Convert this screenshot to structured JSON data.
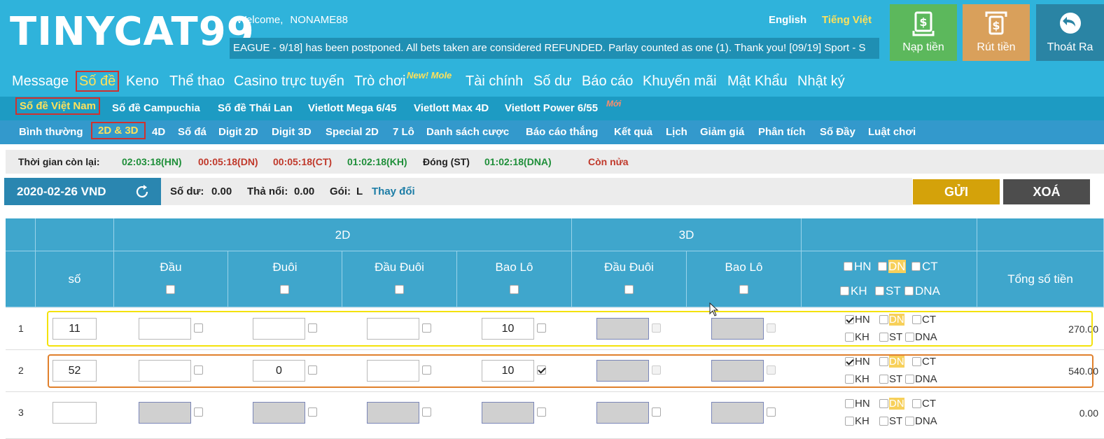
{
  "header": {
    "logo": "TINYCAT99",
    "welcome_label": "Welcome,",
    "username": "NONAME88",
    "lang_english": "English",
    "lang_vietnamese": "Tiếng Việt",
    "marquee": "EAGUE - 9/18] has been postponed. All bets taken are considered REFUNDED. Parlay counted as one (1). Thank you!      [09/19] Sport - S",
    "deposit": "Nạp tiền",
    "withdraw": "Rút tiền",
    "logout": "Thoát Ra"
  },
  "nav": {
    "items": [
      "Message",
      "Số đề",
      "Keno",
      "Thể thao",
      "Casino trực tuyến",
      "Trò chơi",
      "Tài chính",
      "Số dư",
      "Báo cáo",
      "Khuyến mãi",
      "Mật Khẩu",
      "Nhật ký"
    ],
    "new_badge": "New! Mole"
  },
  "subnav": {
    "items": [
      "Số đề Việt Nam",
      "Số đề Campuchia",
      "Số đề Thái Lan",
      "Vietlott Mega 6/45",
      "Vietlott Max 4D",
      "Vietlott Power 6/55"
    ],
    "new_badge": "Mới"
  },
  "gamenav": {
    "items": [
      "Bình thường",
      "2D & 3D",
      "4D",
      "Số đá",
      "Digit 2D",
      "Digit 3D",
      "Special 2D",
      "7 Lô",
      "Danh sách cược",
      "Báo cáo thắng",
      "Kết quả",
      "Lịch",
      "Giảm giá",
      "Phân tích",
      "Số Đầy",
      "Luật chơi"
    ]
  },
  "timer": {
    "label": "Thời gian còn lại:",
    "hn": "02:03:18(HN)",
    "dn": "00:05:18(DN)",
    "ct": "00:05:18(CT)",
    "kh": "01:02:18(KH)",
    "st": "Đóng (ST)",
    "dna": "01:02:18(DNA)",
    "more": "Còn nửa"
  },
  "account": {
    "date": "2020-02-26 VND",
    "balance_label": "Số dư:",
    "balance": "0.00",
    "float_label": "Thả nổi:",
    "float": "0.00",
    "package_label": "Gói:",
    "package": "L",
    "change": "Thay đổi",
    "send": "GỬI",
    "clear": "XOÁ"
  },
  "table": {
    "group_2d": "2D",
    "group_3d": "3D",
    "col_number": "số",
    "col_dau": "Đầu",
    "col_duoi": "Đuôi",
    "col_dauduoi": "Đầu Đuôi",
    "col_baolo": "Bao Lô",
    "col_3d_dauduoi": "Đầu Đuôi",
    "col_3d_baolo": "Bao Lô",
    "col_total": "Tổng số tiền",
    "regions": [
      "HN",
      "DN",
      "CT",
      "KH",
      "ST",
      "DNA"
    ],
    "rows": [
      {
        "idx": "1",
        "number": "11",
        "dau": "",
        "duoi": "",
        "dauduoi": "",
        "baolo": "10",
        "total": "270.00"
      },
      {
        "idx": "2",
        "number": "52",
        "dau": "",
        "duoi": "0",
        "dauduoi": "",
        "baolo": "10",
        "total": "540.00"
      },
      {
        "idx": "3",
        "number": "",
        "dau": "",
        "duoi": "",
        "dauduoi": "",
        "baolo": "",
        "total": "0.00"
      }
    ]
  }
}
